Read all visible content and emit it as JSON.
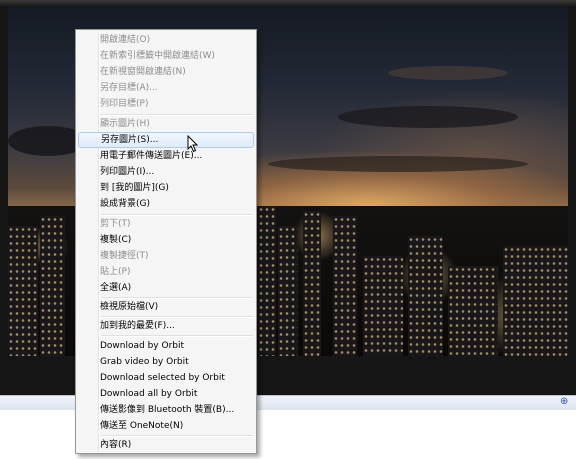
{
  "menu": {
    "items": [
      {
        "label": "開啟連結(O)",
        "enabled": false
      },
      {
        "label": "在新索引標籤中開啟連結(W)",
        "enabled": false
      },
      {
        "label": "在新視窗開啟連結(N)",
        "enabled": false
      },
      {
        "label": "另存目標(A)...",
        "enabled": false
      },
      {
        "label": "列印目標(P)",
        "enabled": false
      },
      {
        "label": "顯示圖片(H)",
        "enabled": false
      },
      {
        "label": "另存圖片(S)...",
        "enabled": true,
        "highlighted": true
      },
      {
        "label": "用電子郵件傳送圖片(E)...",
        "enabled": true
      },
      {
        "label": "列印圖片(I)...",
        "enabled": true
      },
      {
        "label": "到 [我的圖片](G)",
        "enabled": true
      },
      {
        "label": "設成背景(G)",
        "enabled": true
      },
      {
        "label": "剪下(T)",
        "enabled": false
      },
      {
        "label": "複製(C)",
        "enabled": true
      },
      {
        "label": "複製捷徑(T)",
        "enabled": false
      },
      {
        "label": "貼上(P)",
        "enabled": false
      },
      {
        "label": "全選(A)",
        "enabled": true
      },
      {
        "label": "檢視原始檔(V)",
        "enabled": true
      },
      {
        "label": "加到我的最愛(F)...",
        "enabled": true
      },
      {
        "label": "Download by Orbit",
        "enabled": true
      },
      {
        "label": "Grab video by Orbit",
        "enabled": true
      },
      {
        "label": "Download selected by Orbit",
        "enabled": true
      },
      {
        "label": "Download all by Orbit",
        "enabled": true
      },
      {
        "label": "傳送影像到 Bluetooth 裝置(B)...",
        "enabled": true
      },
      {
        "label": "傳送至 OneNote(N)",
        "enabled": true
      },
      {
        "label": "內容(R)",
        "enabled": true
      }
    ]
  },
  "statusbar": {
    "zoom_icon": "zoom-icon"
  },
  "colors": {
    "menu_background": "#f5f5f5",
    "menu_border": "#979797",
    "highlight_border": "#aeccf1",
    "disabled_text": "#8d8d8d"
  }
}
